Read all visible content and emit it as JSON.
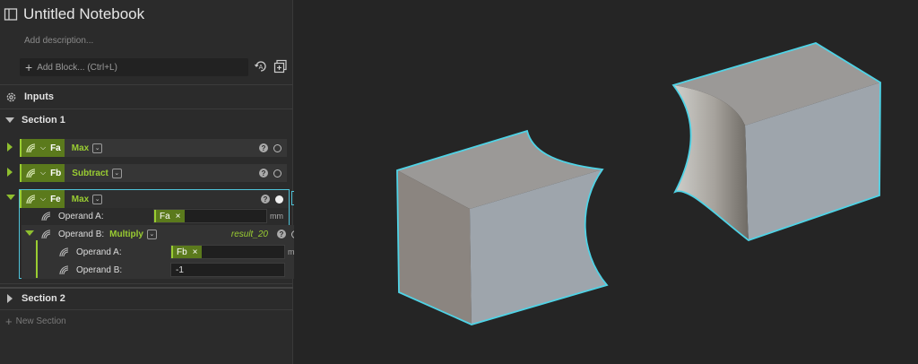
{
  "notebook": {
    "title": "Untitled Notebook",
    "description_placeholder": "Add description...",
    "add_block_label": "Add Block... (Ctrl+L)"
  },
  "inputs_label": "Inputs",
  "sections": [
    {
      "name": "Section 1",
      "expanded": true
    },
    {
      "name": "Section 2",
      "expanded": false
    }
  ],
  "blocks": [
    {
      "var": "Fa",
      "fn": "Max"
    },
    {
      "var": "Fb",
      "fn": "Subtract"
    },
    {
      "var": "Fe",
      "fn": "Max",
      "operand_a": {
        "label": "Operand A:",
        "ref": "Fa",
        "unit": "mm"
      },
      "operand_b": {
        "label": "Operand B:",
        "fn": "Multiply",
        "result": "result_20",
        "operand_a": {
          "label": "Operand A:",
          "ref": "Fb",
          "unit": "mm"
        },
        "operand_b": {
          "label": "Operand B:",
          "value": "-1"
        }
      }
    }
  ],
  "new_section_label": "New Section",
  "colors": {
    "accent": "#9acd32",
    "selection": "#4fc3d9",
    "chip": "#5b7a1c"
  },
  "icons": {
    "help": "?",
    "close": "×",
    "add": "+"
  }
}
